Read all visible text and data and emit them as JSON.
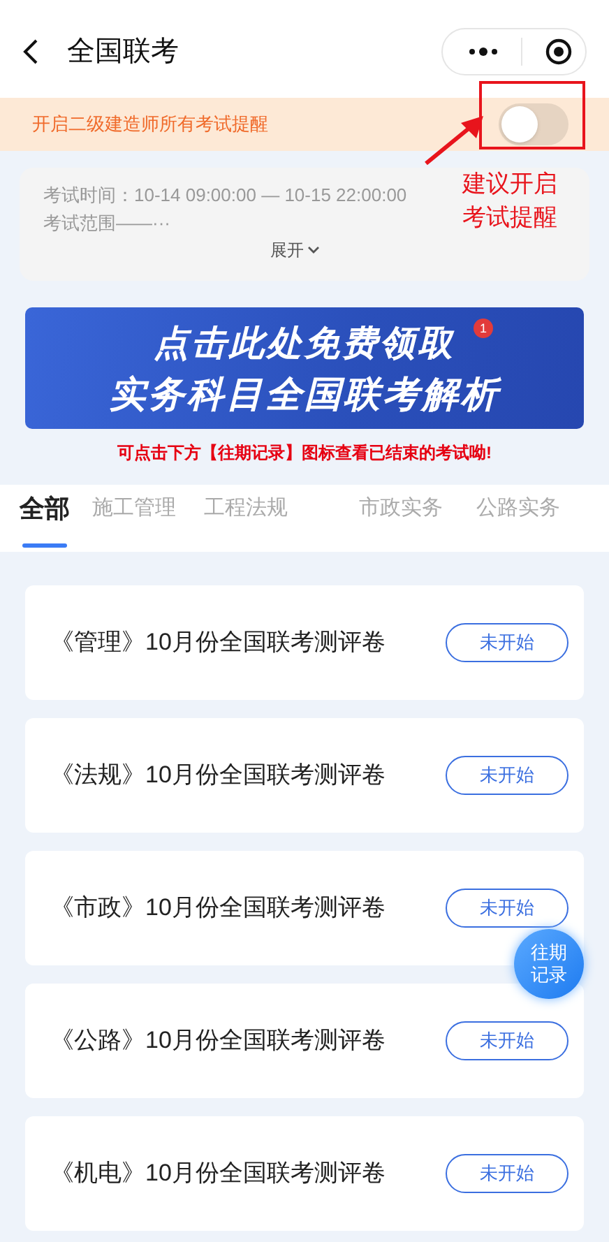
{
  "header": {
    "title": "全国联考"
  },
  "reminder": {
    "text": "开启二级建造师所有考试提醒",
    "on": false
  },
  "annotation": {
    "text": "建议开启考试提醒"
  },
  "info": {
    "time_label": "考试时间：",
    "time_value": "10-14 09:00:00 — 10-15 22:00:00",
    "scope": "考试范围——···",
    "expand": "展开"
  },
  "promo": {
    "line_1": "点击此处免费领取",
    "line_2": "实务科目全国联考解析",
    "badge": "1"
  },
  "notice": "可点击下方【往期记录】图标查看已结束的考试呦!",
  "tabs": [
    {
      "label": "全部",
      "selected": true
    },
    {
      "label": "施工管理",
      "selected": false
    },
    {
      "label": "工程法规",
      "selected": false
    },
    {
      "label": "市政实务",
      "selected": false
    },
    {
      "label": "公路实务",
      "selected": false
    }
  ],
  "exams": [
    {
      "title": "《管理》10月份全国联考测评卷",
      "status": "未开始"
    },
    {
      "title": "《法规》10月份全国联考测评卷",
      "status": "未开始"
    },
    {
      "title": "《市政》10月份全国联考测评卷",
      "status": "未开始"
    },
    {
      "title": "《公路》10月份全国联考测评卷",
      "status": "未开始"
    },
    {
      "title": "《机电》10月份全国联考测评卷",
      "status": "未开始"
    }
  ],
  "history_button": {
    "line_1": "往期",
    "line_2": "记录"
  }
}
